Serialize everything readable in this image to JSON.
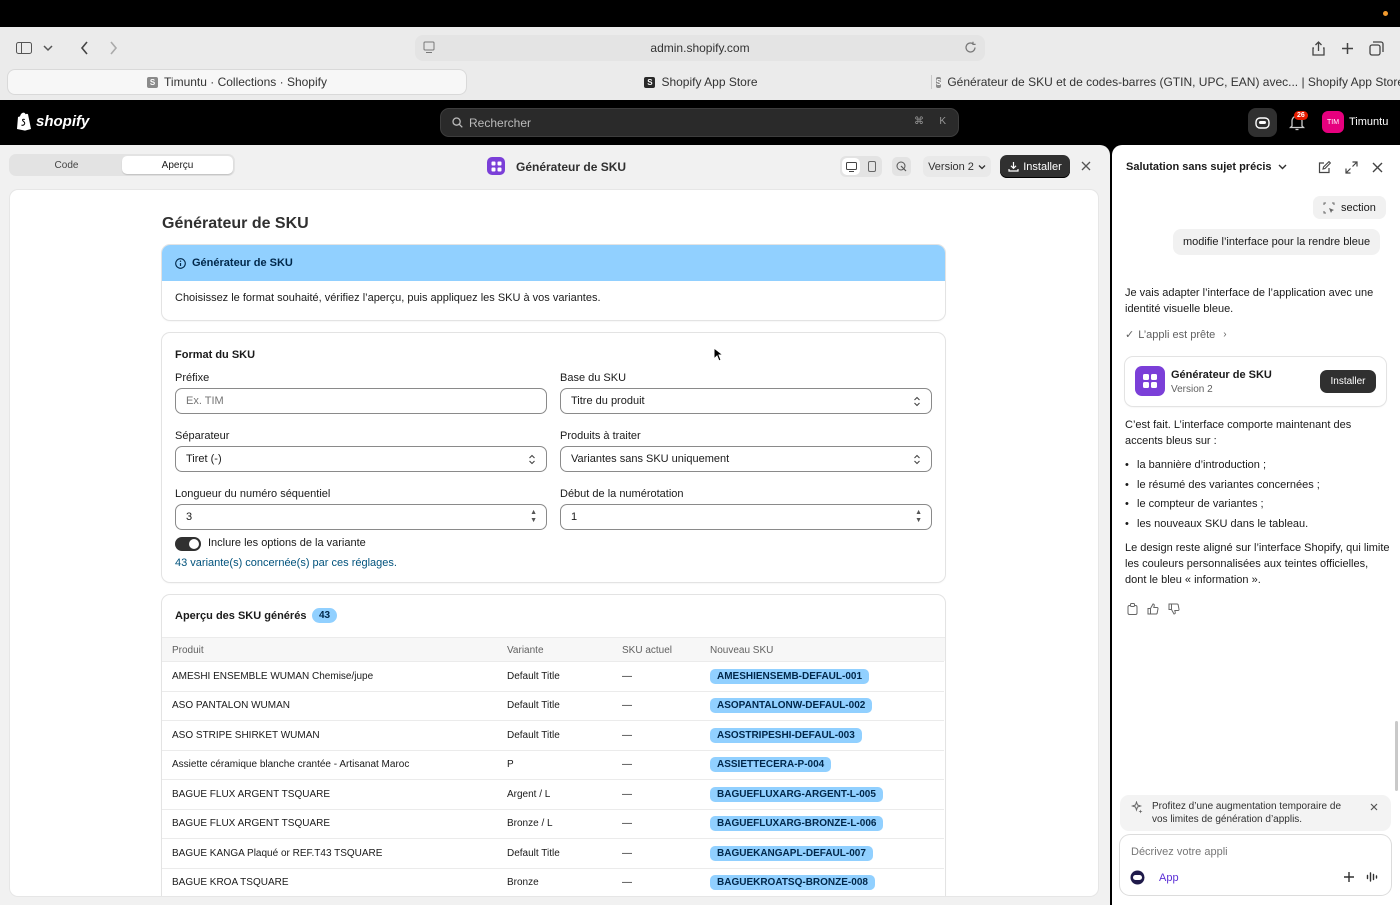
{
  "browser": {
    "url": "admin.shopify.com",
    "tabs": [
      {
        "label": "Timuntu · Collections · Shopify",
        "favicon": "S"
      },
      {
        "label": "Shopify App Store",
        "favicon": "bag"
      },
      {
        "label": "Générateur de SKU et de codes-barres (GTIN, UPC, EAN) avec... | Shopify App Store",
        "favicon": "S"
      }
    ]
  },
  "shopify": {
    "logo_text": "shopify",
    "search_placeholder": "Rechercher",
    "search_shortcut_cmd": "⌘",
    "search_shortcut_key": "K",
    "notification_count": "26",
    "avatar_initials": "TIM",
    "store_name": "Timuntu"
  },
  "editor": {
    "tabs": [
      "Code",
      "Aperçu"
    ],
    "active_tab": "Aperçu",
    "app_name": "Générateur de SKU",
    "version_label": "Version 2",
    "install_label": "Installer"
  },
  "app": {
    "page_title": "Générateur de SKU",
    "banner_title": "Générateur de SKU",
    "banner_text": "Choisissez le format souhaité, vérifiez l’aperçu, puis appliquez les SKU à vos variantes.",
    "format_section_title": "Format du SKU",
    "fields": {
      "prefix_label": "Préfixe",
      "prefix_placeholder": "Ex. TIM",
      "base_label": "Base du SKU",
      "base_value": "Titre du produit",
      "separator_label": "Séparateur",
      "separator_value": "Tiret (-)",
      "products_label": "Produits à traiter",
      "products_value": "Variantes sans SKU uniquement",
      "seq_length_label": "Longueur du numéro séquentiel",
      "seq_length_value": "3",
      "start_label": "Début de la numérotation",
      "start_value": "1",
      "toggle_label": "Inclure les options de la variante",
      "toggle_on": true,
      "summary": "43 variante(s) concernée(s) par ces réglages."
    },
    "preview_title": "Aperçu des SKU générés",
    "preview_count": "43",
    "table_headers": [
      "Produit",
      "Variante",
      "SKU actuel",
      "Nouveau SKU"
    ],
    "rows": [
      {
        "product": "AMESHI ENSEMBLE WUMAN Chemise/jupe",
        "variant": "Default Title",
        "current": "—",
        "new": "AMESHIENSEMB-DEFAUL-001"
      },
      {
        "product": "ASO PANTALON WUMAN",
        "variant": "Default Title",
        "current": "—",
        "new": "ASOPANTALONW-DEFAUL-002"
      },
      {
        "product": "ASO STRIPE SHIRKET WUMAN",
        "variant": "Default Title",
        "current": "—",
        "new": "ASOSTRIPESHI-DEFAUL-003"
      },
      {
        "product": "Assiette céramique blanche crantée - Artisanat Maroc",
        "variant": "P",
        "current": "—",
        "new": "ASSIETTECERA-P-004"
      },
      {
        "product": "BAGUE FLUX ARGENT TSQUARE",
        "variant": "Argent / L",
        "current": "—",
        "new": "BAGUEFLUXARG-ARGENT-L-005"
      },
      {
        "product": "BAGUE FLUX ARGENT TSQUARE",
        "variant": "Bronze / L",
        "current": "—",
        "new": "BAGUEFLUXARG-BRONZE-L-006"
      },
      {
        "product": "BAGUE KANGA Plaqué or REF.T43 TSQUARE",
        "variant": "Default Title",
        "current": "—",
        "new": "BAGUEKANGAPL-DEFAUL-007"
      },
      {
        "product": "BAGUE KROA TSQUARE",
        "variant": "Bronze",
        "current": "—",
        "new": "BAGUEKROATSQ-BRONZE-008"
      }
    ],
    "accent_color": "#91d0ff"
  },
  "chat": {
    "title": "Salutation sans sujet précis",
    "context_chip": "section",
    "user_message": "modifie l’interface pour la rendre bleue",
    "reply_intro": "Je vais adapter l’interface de l’application avec une identité visuelle bleue.",
    "status": "L’appli est prête",
    "app_card": {
      "name": "Générateur de SKU",
      "version": "Version 2",
      "button": "Installer"
    },
    "reply_body": "C’est fait. L’interface comporte maintenant des accents bleus sur :",
    "bullets": [
      "la bannière d’introduction ;",
      "le résumé des variantes concernées ;",
      "le compteur de variantes ;",
      "les nouveaux SKU dans le tableau."
    ],
    "reply_outro": "Le design reste aligné sur l’interface Shopify, qui limite les couleurs personnalisées aux teintes officielles, dont le bleu « information ».",
    "promo": "Profitez d’une augmentation temporaire de vos limites de génération d’applis.",
    "composer_placeholder": "Décrivez votre appli",
    "composer_chip": "App"
  }
}
